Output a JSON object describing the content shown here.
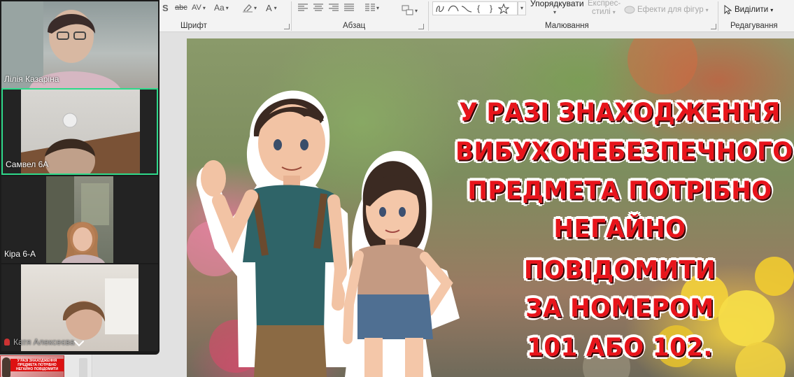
{
  "ribbon": {
    "groups": {
      "font": "Шрифт",
      "paragraph": "Абзац",
      "drawing": "Малювання",
      "editing": "Редагування"
    },
    "buttons": {
      "arrange": "Упорядкувати",
      "quick_styles_line1": "Експрес-",
      "quick_styles_line2": "стилі",
      "shape_effects": "Ефекти для фігур",
      "select": "Виділити",
      "font_size_aa": "Aa",
      "strikethrough": "abc",
      "spacing": "AV",
      "font_color": "A"
    },
    "shape_glyphs": [
      "{",
      "}"
    ]
  },
  "participants": [
    {
      "name": "Лілія Казаріна",
      "muted": false,
      "active": false
    },
    {
      "name": "Самвел 6А",
      "muted": false,
      "active": true
    },
    {
      "name": "Кіра 6-А",
      "muted": false,
      "active": false
    },
    {
      "name": "Катя Алексеєва",
      "muted": true,
      "active": false
    }
  ],
  "slide": {
    "lines": [
      "У РАЗІ ЗНАХОДЖЕННЯ",
      "ВИБУХОНЕБЕЗПЕЧНОГО",
      "ПРЕДМЕТА ПОТРІБНО",
      "НЕГАЙНО ПОВІДОМИТИ",
      "ЗА НОМЕРОМ",
      "101 АБО 102."
    ]
  },
  "colors": {
    "active_border": "#2fd98b",
    "slide_text": "#e8141b"
  }
}
